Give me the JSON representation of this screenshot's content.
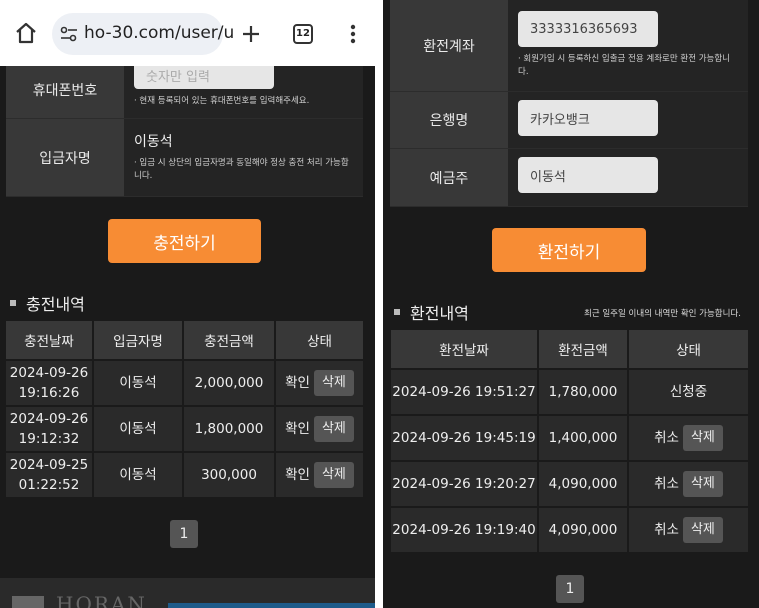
{
  "browser": {
    "url": "ho-30.com/user/u",
    "tab_count": "12"
  },
  "deposit": {
    "phone_label": "휴대폰번호",
    "phone_placeholder": "숫자만 입력",
    "phone_note": "· 현재 등록되어 있는 휴대폰번호를 입력해주세요.",
    "depositor_label": "입금자명",
    "depositor_value": "이동석",
    "depositor_note_1": "· 입금 시 상단의 입금자명과 동일해야 정상 충전 처리 가능합",
    "depositor_note_2": "니다.",
    "submit_label": "충전하기",
    "history_title": "충전내역",
    "columns": [
      "충전날짜",
      "입금자명",
      "충전금액",
      "상태"
    ],
    "rows": [
      {
        "date": "2024-09-26",
        "time": "19:16:26",
        "name": "이동석",
        "amount": "2,000,000",
        "status": "확인",
        "action": "삭제"
      },
      {
        "date": "2024-09-26",
        "time": "19:12:32",
        "name": "이동석",
        "amount": "1,800,000",
        "status": "확인",
        "action": "삭제"
      },
      {
        "date": "2024-09-25",
        "time": "01:22:52",
        "name": "이동석",
        "amount": "300,000",
        "status": "확인",
        "action": "삭제"
      }
    ],
    "page": "1",
    "footer_logo": "HORAN"
  },
  "withdraw": {
    "account_label": "환전계좌",
    "account_value": "3333316365693",
    "account_note_1": "· 회원가입 시 등록하신 입출금 전용 계좌로만 환전 가능합니",
    "account_note_2": "다.",
    "bank_label": "은행명",
    "bank_value": "카카오뱅크",
    "holder_label": "예금주",
    "holder_value": "이동석",
    "submit_label": "환전하기",
    "history_title": "환전내역",
    "history_note": "최근 일주일 이내의 내역만 확인 가능합니다.",
    "columns": [
      "환전날짜",
      "환전금액",
      "상태"
    ],
    "rows": [
      {
        "datetime": "2024-09-26 19:51:27",
        "amount": "1,780,000",
        "status": "신청중",
        "action": ""
      },
      {
        "datetime": "2024-09-26 19:45:19",
        "amount": "1,400,000",
        "status": "취소",
        "action": "삭제"
      },
      {
        "datetime": "2024-09-26 19:20:27",
        "amount": "4,090,000",
        "status": "취소",
        "action": "삭제"
      },
      {
        "datetime": "2024-09-26 19:19:40",
        "amount": "4,090,000",
        "status": "취소",
        "action": "삭제"
      }
    ],
    "page": "1"
  },
  "colors": {
    "accent": "#f78c34",
    "background": "#1a1a1a",
    "header_cell": "#383838"
  }
}
